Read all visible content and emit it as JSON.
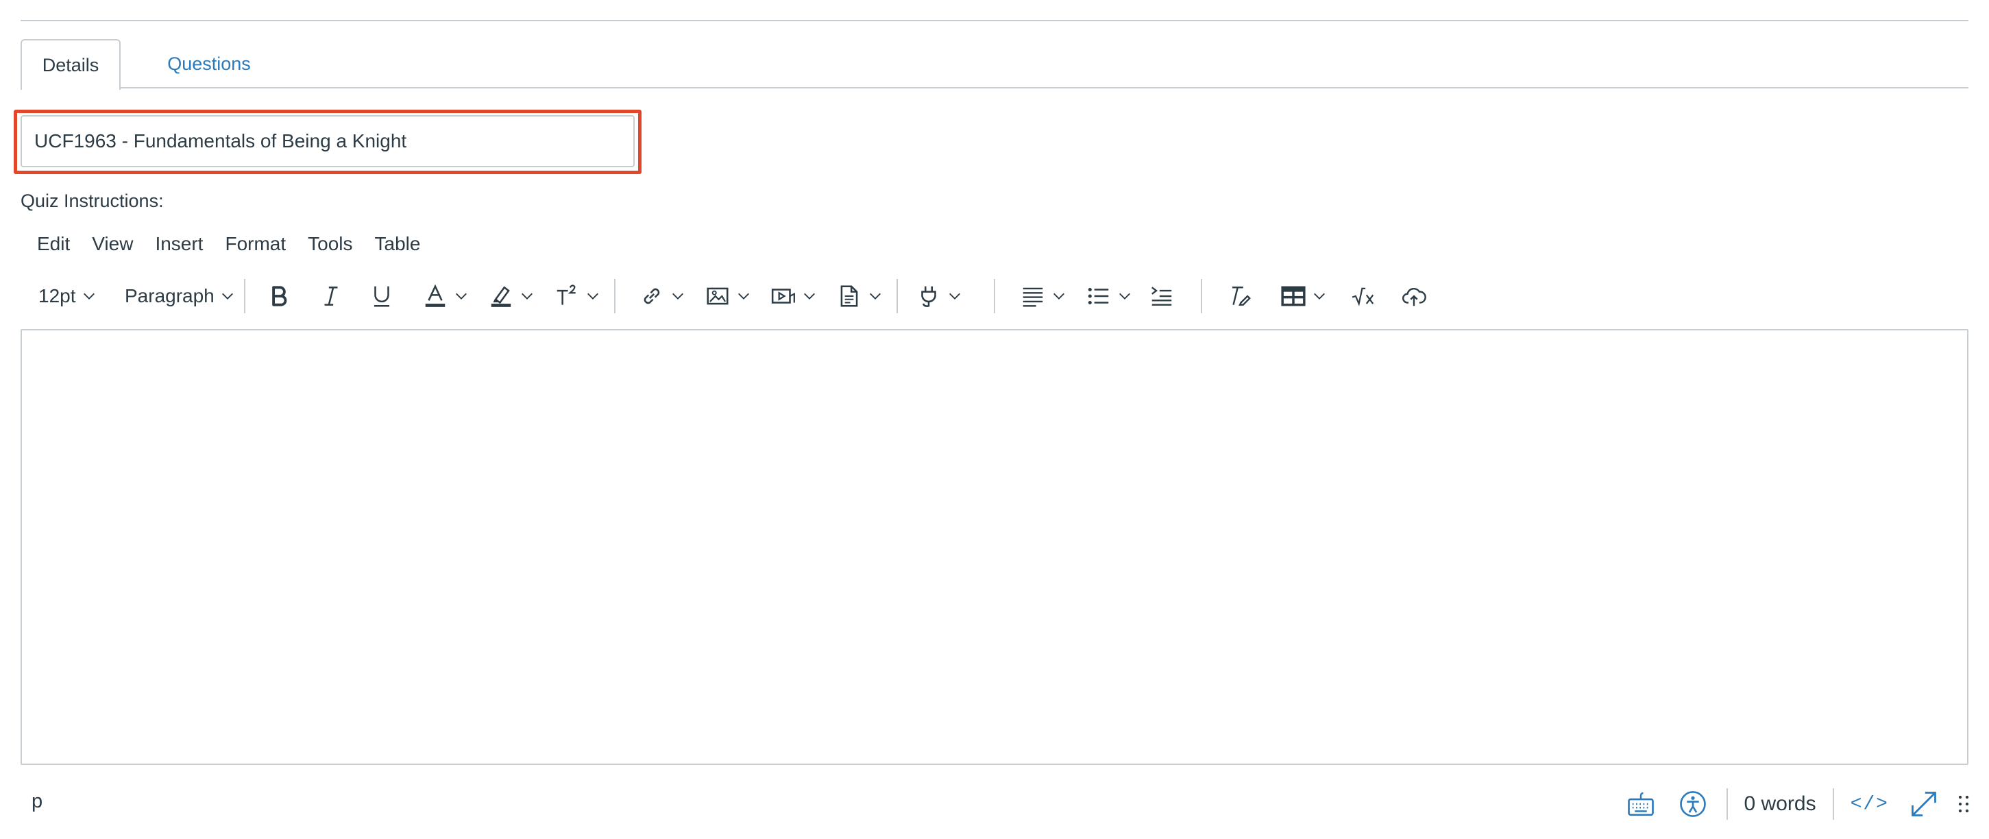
{
  "tabs": [
    {
      "label": "Details",
      "active": true
    },
    {
      "label": "Questions",
      "active": false
    }
  ],
  "title_field": {
    "value": "UCF1963 - Fundamentals of Being a Knight",
    "highlight_color": "#e0472b"
  },
  "instructions_label": "Quiz Instructions:",
  "menubar": [
    "Edit",
    "View",
    "Insert",
    "Format",
    "Tools",
    "Table"
  ],
  "toolbar": {
    "font_size": "12pt",
    "block_format": "Paragraph",
    "icons": [
      "bold-icon",
      "italic-icon",
      "underline-icon",
      "text-color-icon",
      "highlight-icon",
      "superscript-icon",
      "link-icon",
      "image-icon",
      "media-icon",
      "document-icon",
      "plugin-icon",
      "align-icon",
      "list-icon",
      "indent-icon",
      "clear-formatting-icon",
      "table-icon",
      "equation-icon",
      "upload-cloud-icon"
    ]
  },
  "status_bar": {
    "path": "p",
    "word_count": "0 words",
    "html_toggle": "</>"
  },
  "colors": {
    "link": "#2b7abc",
    "text": "#2d3b45",
    "border": "#c7cdd1"
  }
}
